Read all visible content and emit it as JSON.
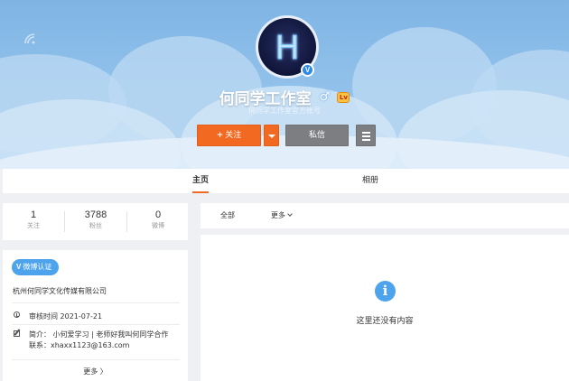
{
  "profile": {
    "name": "何同学工作室",
    "description": "何同学工作室官方账号",
    "avatar_letter": "H",
    "verified_mark": "V",
    "gender_symbol": "♂",
    "level_icon_text": "Lv"
  },
  "actions": {
    "follow_plus": "+",
    "follow_label": "关注",
    "message_label": "私信"
  },
  "tabs": [
    {
      "label": "主页",
      "active": true
    },
    {
      "label": "相册",
      "active": false
    }
  ],
  "stats": [
    {
      "value": "1",
      "label": "关注"
    },
    {
      "value": "3788",
      "label": "粉丝"
    },
    {
      "value": "0",
      "label": "微博"
    }
  ],
  "info": {
    "badge_v": "V",
    "badge_label": "微博认证",
    "company": "杭州何同学文化传媒有限公司",
    "review_time": "审核时间 2021-07-21",
    "intro_line1": "简介：  小何爱学习 | 老师好我叫何同学合作",
    "intro_line2": "联系：xhaxx1123@163.com",
    "more_label": "更多 〉"
  },
  "filters": {
    "all_label": "全部",
    "more_label": "更多"
  },
  "feed": {
    "empty_icon": "i",
    "empty_text": "这里还没有内容"
  },
  "colors": {
    "accent_orange": "#f26922",
    "button_gray": "#7c7e82",
    "verified_blue": "#4da3ec",
    "cover_blue": "#8fc0ea"
  },
  "icons": [
    "wifi-icon",
    "verified-icon",
    "gender-icon",
    "level-icon",
    "dropdown-icon",
    "menu-icon",
    "clock-icon",
    "edit-icon",
    "chevron-down-icon",
    "chevron-right-icon",
    "info-icon"
  ]
}
